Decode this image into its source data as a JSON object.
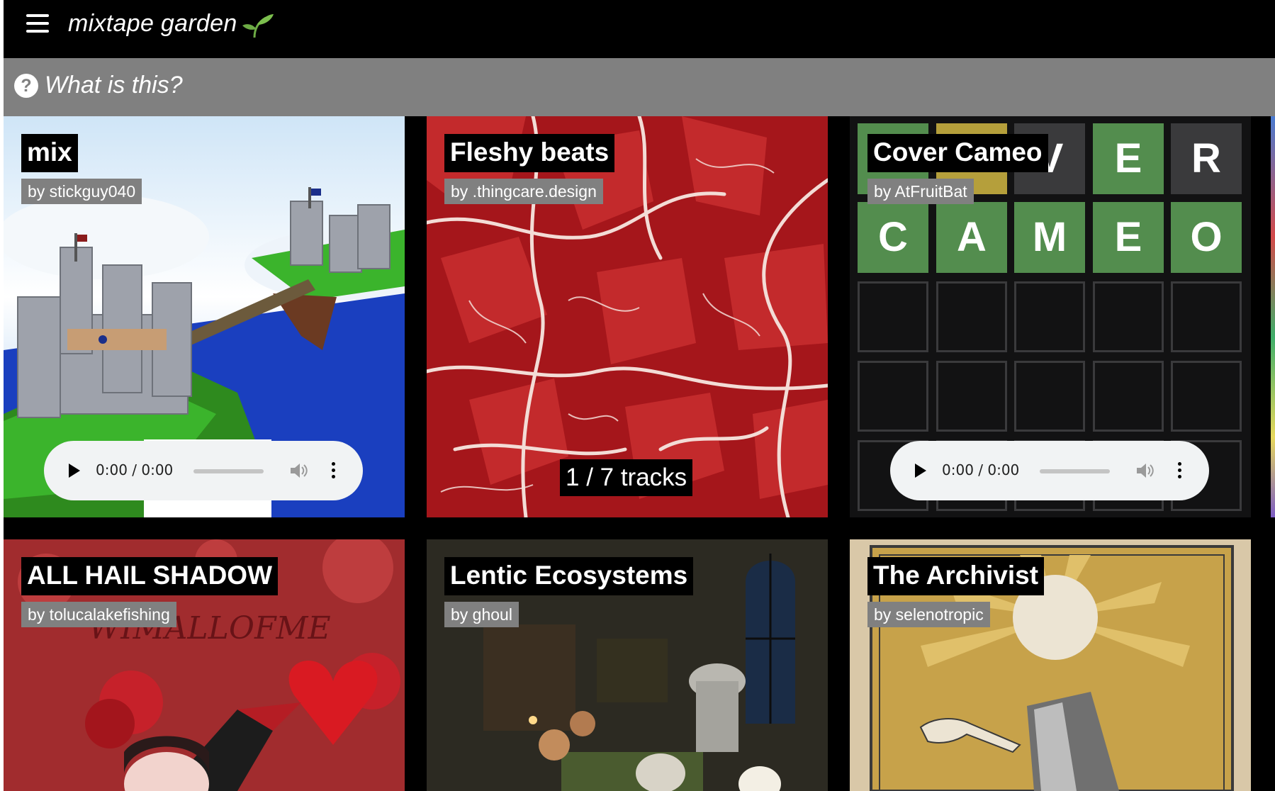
{
  "header": {
    "app_title": "mixtape garden",
    "menu_icon": "hamburger-menu-icon",
    "logo_icon": "sprout-icon"
  },
  "info_bar": {
    "icon": "question-circle-icon",
    "text": "What is this?"
  },
  "tiles": [
    {
      "title": "mix",
      "author": "by stickguy040",
      "cover": "castle-island-image",
      "player": {
        "time": "0:00 / 0:00"
      }
    },
    {
      "title": "Fleshy beats",
      "author": "by .thingcare.design",
      "cover": "raw-meat-texture-image",
      "track_count": "1 / 7 tracks"
    },
    {
      "title": "Cover Cameo",
      "author": "by AtFruitBat",
      "cover": "word-puzzle-grid-image",
      "wordle_letters": [
        [
          "",
          "",
          "V",
          "E",
          "R"
        ],
        [
          "C",
          "A",
          "M",
          "E",
          "O"
        ]
      ],
      "player": {
        "time": "0:00 / 0:00"
      }
    },
    {
      "title": "ALL HAIL SHADOW",
      "author": "by tolucalakefishing",
      "cover": "red-collage-image"
    },
    {
      "title": "Lentic Ecosystems",
      "author": "by ghoul",
      "cover": "alchemist-painting-image"
    },
    {
      "title": "The Archivist",
      "author": "by selenotropic",
      "cover": "sun-tarot-card-image"
    }
  ],
  "colors": {
    "background": "#000000",
    "info_bar": "#808080",
    "author_badge": "#808080",
    "player_bg": "#f1f3f4",
    "wordle_green": "#538d4e",
    "wordle_yellow": "#b59f3b",
    "wordle_gray": "#3a3a3c"
  }
}
